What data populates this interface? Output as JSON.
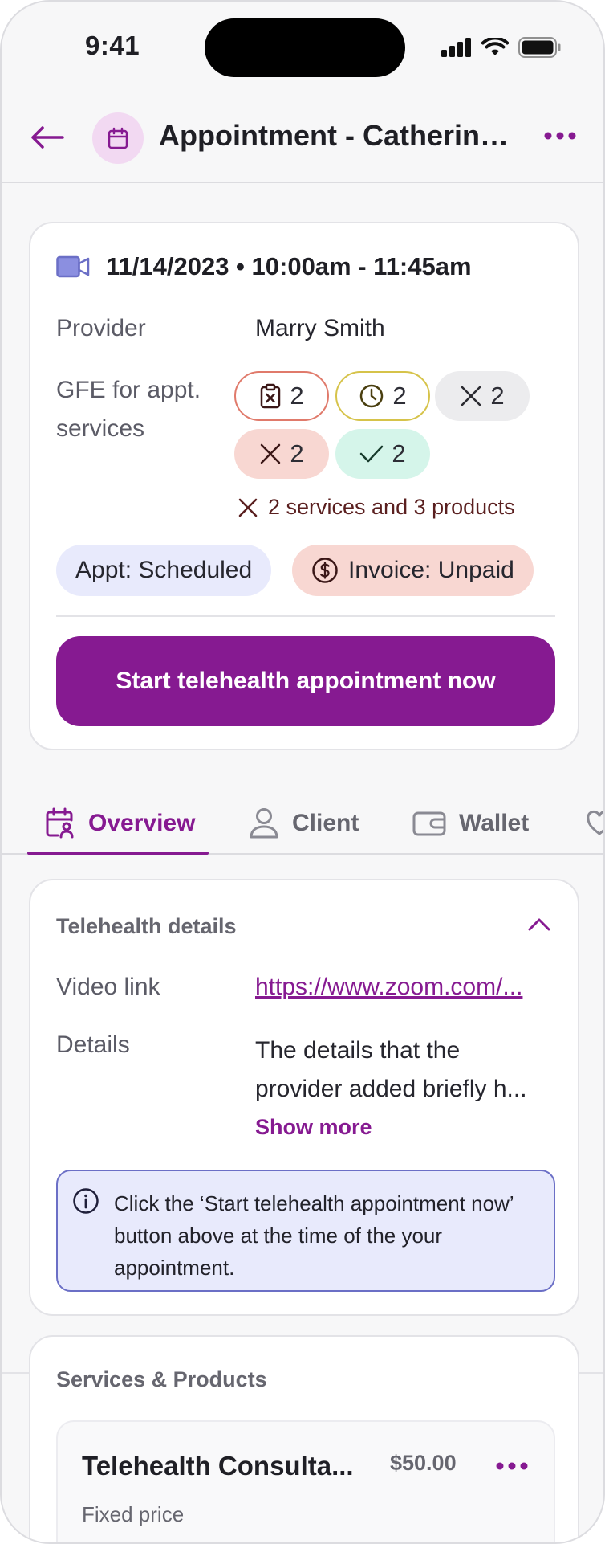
{
  "status_bar": {
    "time": "9:41"
  },
  "header": {
    "title": "Appointment - Catherine..."
  },
  "appointment": {
    "datetime": "11/14/2023 • 10:00am - 11:45am",
    "provider_label": "Provider",
    "provider_value": "Marry Smith",
    "gfe_label_line1": "GFE for appt.",
    "gfe_label_line2": "services",
    "gfe_chips": [
      {
        "icon": "clipboard-x-icon",
        "count": "2"
      },
      {
        "icon": "clock-icon",
        "count": "2"
      },
      {
        "icon": "x-icon",
        "count": "2"
      },
      {
        "icon": "x-icon",
        "count": "2"
      },
      {
        "icon": "check-icon",
        "count": "2"
      }
    ],
    "gfe_note": "2 services and 3 products",
    "appt_status": "Appt: Scheduled",
    "invoice_status": "Invoice: Unpaid",
    "start_button": "Start telehealth appointment now"
  },
  "tabs": [
    {
      "label": "Overview",
      "icon": "calendar-user-icon",
      "active": true
    },
    {
      "label": "Client",
      "icon": "user-icon",
      "active": false
    },
    {
      "label": "Wallet",
      "icon": "wallet-icon",
      "active": false
    }
  ],
  "telehealth": {
    "title": "Telehealth details",
    "video_label": "Video link",
    "video_value": "https://www.zoom.com/...",
    "details_label": "Details",
    "details_line1": "The details that the",
    "details_line2": "provider added briefly h...",
    "show_more": "Show more",
    "info_text": "Click the ‘Start telehealth appointment now’ button above at the time of the your appointment."
  },
  "services": {
    "title": "Services & Products",
    "item_name": "Telehealth Consulta...",
    "item_price": "$50.00",
    "item_sub": "Fixed price"
  },
  "colors": {
    "brand": "#861a91",
    "info_bg": "#e8eafc",
    "info_border": "#6b6fc6",
    "chip_red_bg": "#f8d7d2",
    "chip_green_bg": "#d5f5ea",
    "chip_gray_bg": "#ececee",
    "appt_status_bg": "#e8eafc"
  }
}
